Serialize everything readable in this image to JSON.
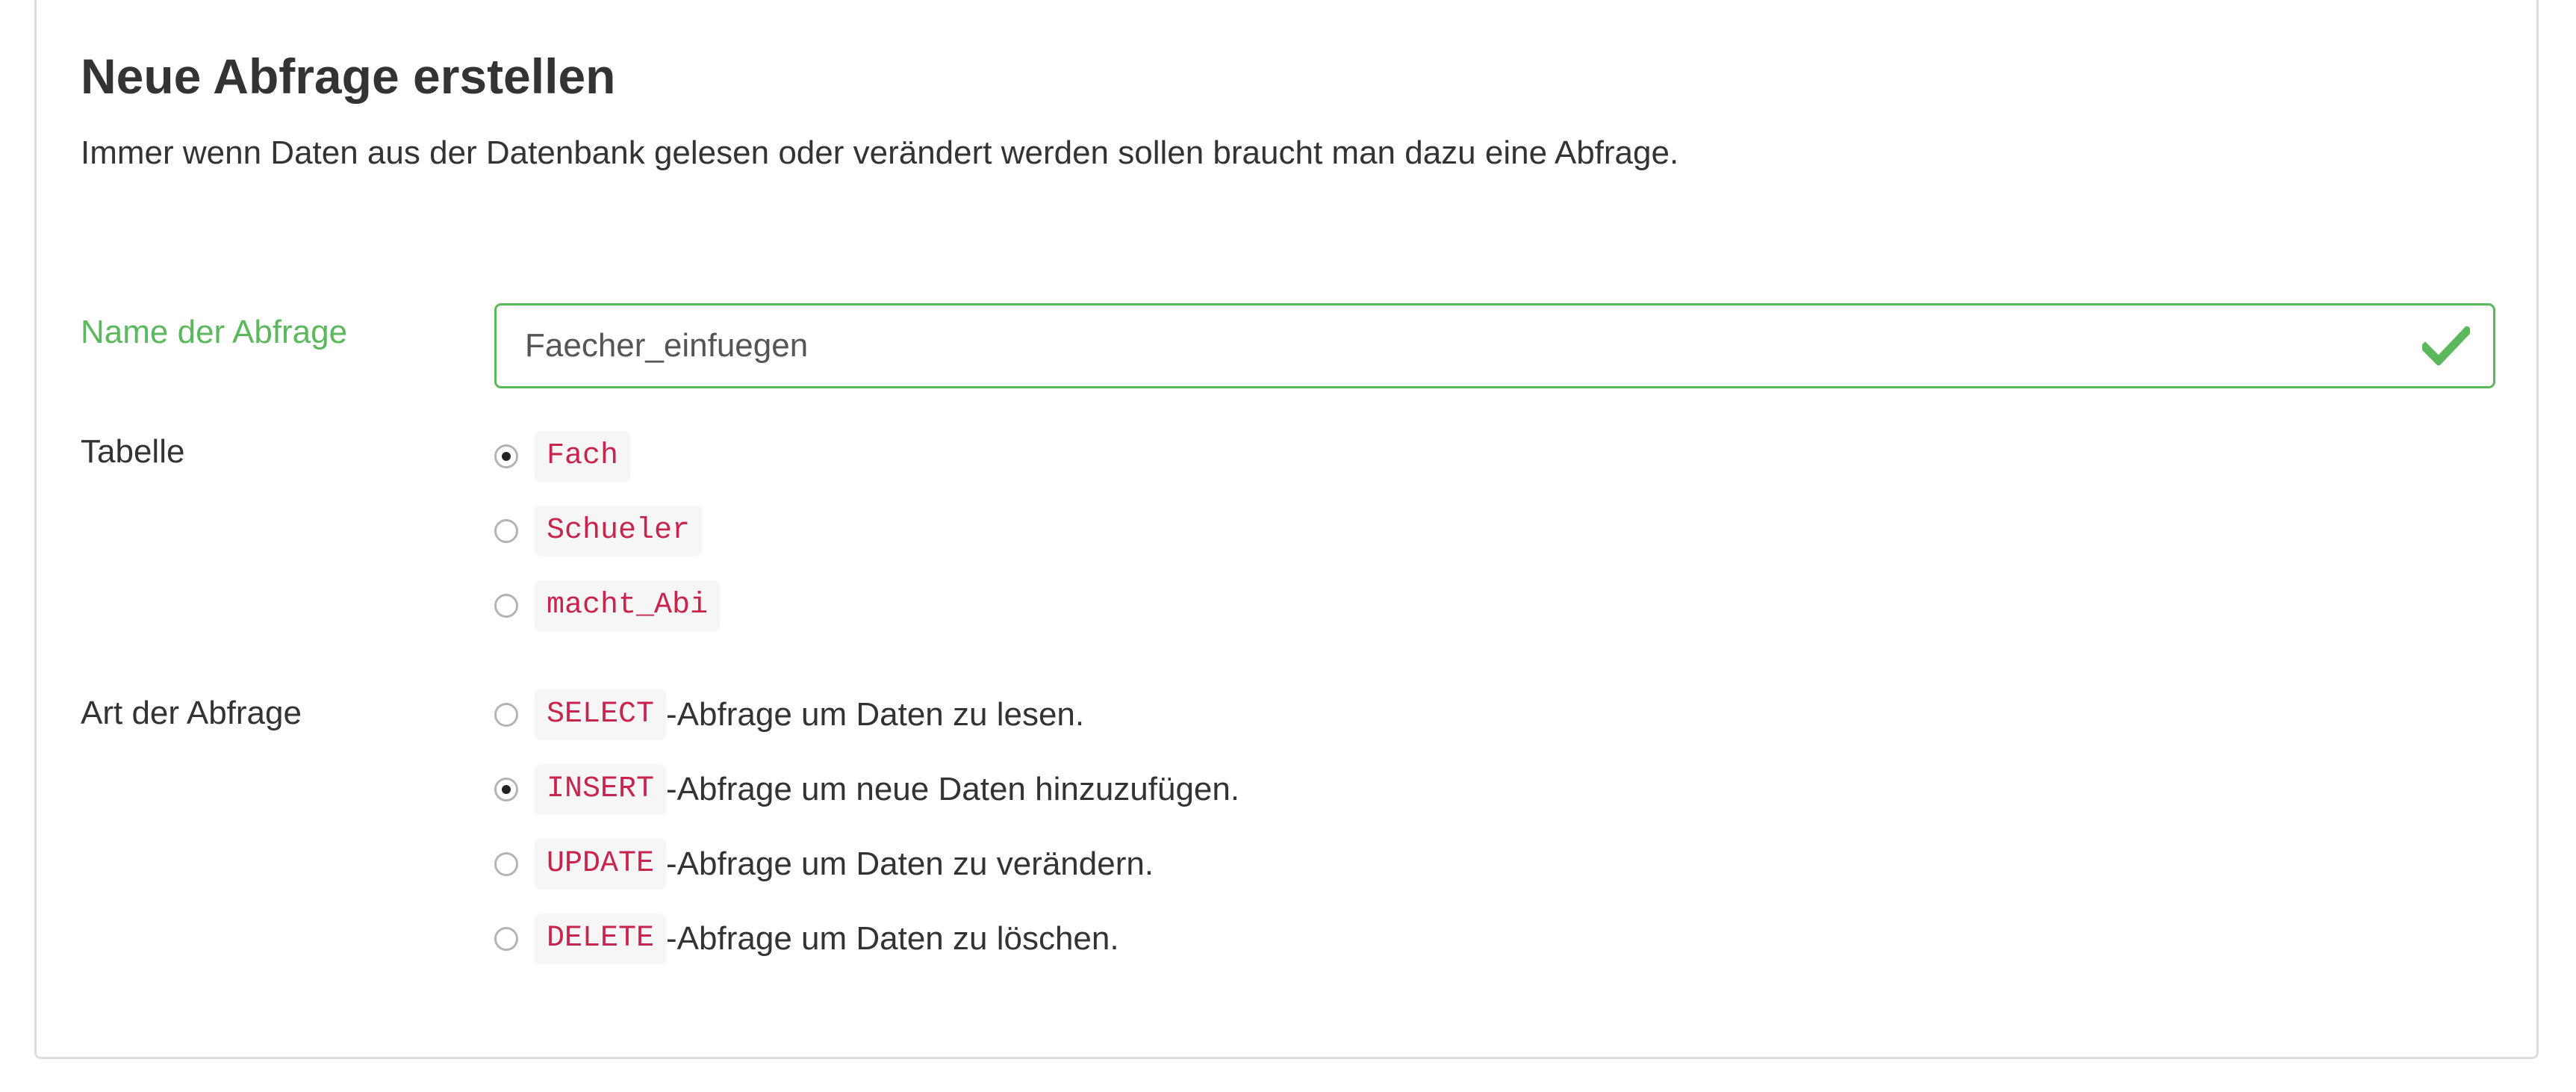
{
  "header": {
    "title": "Neue Abfrage erstellen",
    "description": "Immer wenn Daten aus der Datenbank gelesen oder verändert werden sollen braucht man dazu eine Abfrage."
  },
  "form": {
    "name": {
      "label": "Name der Abfrage",
      "value": "Faecher_einfuegen",
      "status": "valid",
      "status_icon": "check-icon",
      "status_color": "#5cb85c"
    },
    "table": {
      "label": "Tabelle",
      "options": [
        {
          "code": "Fach",
          "checked": true
        },
        {
          "code": "Schueler",
          "checked": false
        },
        {
          "code": "macht_Abi",
          "checked": false
        }
      ]
    },
    "query_type": {
      "label": "Art der Abfrage",
      "options": [
        {
          "code": "SELECT",
          "text": "-Abfrage um Daten zu lesen.",
          "checked": false
        },
        {
          "code": "INSERT",
          "text": "-Abfrage um neue Daten hinzuzufügen.",
          "checked": true
        },
        {
          "code": "UPDATE",
          "text": "-Abfrage um Daten zu verändern.",
          "checked": false
        },
        {
          "code": "DELETE",
          "text": "-Abfrage um Daten zu löschen.",
          "checked": false
        }
      ]
    }
  },
  "colors": {
    "success": "#5cb85c",
    "code_text": "#c7254e",
    "code_bg": "#f6f6f6",
    "text": "#333333"
  }
}
